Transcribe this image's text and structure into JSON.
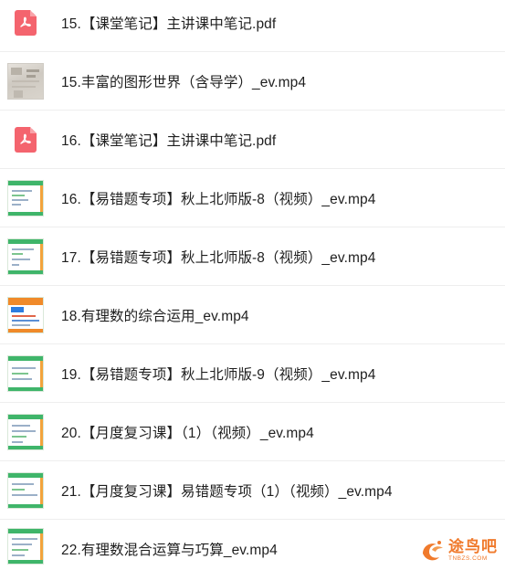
{
  "files": [
    {
      "name": "15.【课堂笔记】主讲课中笔记.pdf",
      "type": "pdf",
      "icon": "pdf-icon"
    },
    {
      "name": "15.丰富的图形世界（含导学）_ev.mp4",
      "type": "video-photo",
      "icon": "video-thumbnail"
    },
    {
      "name": "16.【课堂笔记】主讲课中笔记.pdf",
      "type": "pdf",
      "icon": "pdf-icon"
    },
    {
      "name": "16.【易错题专项】秋上北师版-8（视频）_ev.mp4",
      "type": "video",
      "icon": "video-thumbnail"
    },
    {
      "name": "17.【易错题专项】秋上北师版-8（视频）_ev.mp4",
      "type": "video",
      "icon": "video-thumbnail"
    },
    {
      "name": "18.有理数的综合运用_ev.mp4",
      "type": "video-orange",
      "icon": "video-thumbnail"
    },
    {
      "name": "19.【易错题专项】秋上北师版-9（视频）_ev.mp4",
      "type": "video",
      "icon": "video-thumbnail"
    },
    {
      "name": "20.【月度复习课】（1）（视频）_ev.mp4",
      "type": "video",
      "icon": "video-thumbnail"
    },
    {
      "name": "21.【月度复习课】易错题专项（1）（视频）_ev.mp4",
      "type": "video",
      "icon": "video-thumbnail"
    },
    {
      "name": "22.有理数混合运算与巧算_ev.mp4",
      "type": "video",
      "icon": "video-thumbnail"
    }
  ],
  "watermark": {
    "text_cn": "途鸟吧",
    "text_en": "TNBZS.COM",
    "color": "#f07a2c"
  },
  "colors": {
    "pdf": "#f4646e",
    "video_accent": "#3fb56a",
    "text": "#1f1f1f",
    "divider": "#eeeeee"
  }
}
